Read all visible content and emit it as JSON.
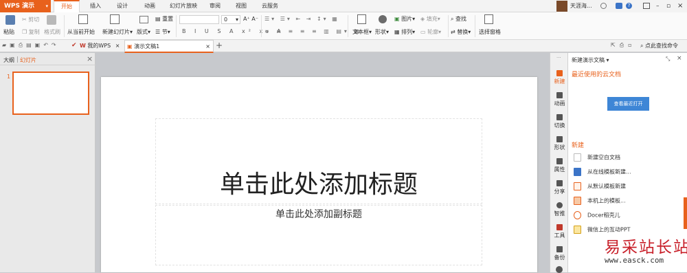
{
  "app": {
    "name": "WPS 演示"
  },
  "menu_tabs": [
    "开始",
    "插入",
    "设计",
    "动画",
    "幻灯片放映",
    "审阅",
    "视图",
    "云服务"
  ],
  "user": {
    "name": "天涯海..."
  },
  "ribbon": {
    "paste": "粘贴",
    "cut": "剪切",
    "copy": "复制",
    "format_painter": "格式刷",
    "from_current": "从当前开始",
    "new_slide": "新建幻灯片",
    "layout": "版式",
    "reset": "重置",
    "section": "节",
    "font_size": "0",
    "textbox": "文本框",
    "shape": "形状",
    "picture": "图片",
    "fill": "填充",
    "arrange": "排列",
    "outline": "轮廓",
    "find": "查找",
    "replace": "替换",
    "select_pane": "选择窗格"
  },
  "quickbar": {
    "search": "点此查找命令"
  },
  "doc_tabs": [
    {
      "label": "我的WPS"
    },
    {
      "label": "演示文稿1"
    }
  ],
  "left_panel": {
    "tab_outline": "大纲",
    "tab_slides": "幻灯片",
    "slide_number": "1"
  },
  "slide": {
    "title": "单击此处添加标题",
    "subtitle": "单击此处添加副标题"
  },
  "sidebar": {
    "items": [
      "新建",
      "动画",
      "切换",
      "形状",
      "属性",
      "分享",
      "智推",
      "工具",
      "备份"
    ]
  },
  "right_panel": {
    "header": "新建演示文稿",
    "recent_title": "最近使用的云文档",
    "recent_button": "查看最近打开",
    "new_title": "新建",
    "new_items": [
      "新建空白文档",
      "从在线模板新建...",
      "从默认模板新建",
      "本机上的模板...",
      "Docer稻壳儿",
      "微信上的互动PPT"
    ]
  },
  "watermark": {
    "text": "易采站长站",
    "url": "www.easck.com"
  },
  "colors": {
    "accent": "#e8611c",
    "button_blue": "#3e86d6"
  }
}
